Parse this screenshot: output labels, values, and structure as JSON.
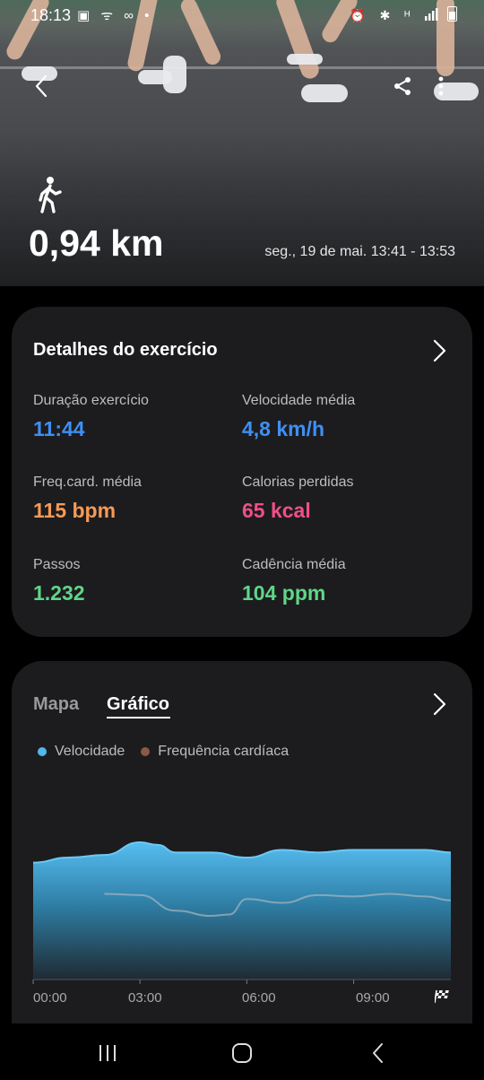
{
  "status_bar": {
    "time": "18:13",
    "left_icons": "▣ ᯤ ∞ •",
    "right_icons": "⏰ ✱ ᴴ"
  },
  "hero": {
    "distance": "0,94 km",
    "datetime": "seg., 19 de mai. 13:41 - 13:53",
    "icons": [
      "back-icon",
      "share-icon",
      "more-icon",
      "walking-icon"
    ]
  },
  "details": {
    "title": "Detalhes do exercício",
    "metrics": [
      {
        "label": "Duração exercício",
        "value": "11:44",
        "color": "#3f8ff3"
      },
      {
        "label": "Velocidade média",
        "value": "4,8 km/h",
        "color": "#3f8ff3"
      },
      {
        "label": "Freq.card. média",
        "value": "115 bpm",
        "color": "#f59a57"
      },
      {
        "label": "Calorias perdidas",
        "value": "65 kcal",
        "color": "#ef4f89"
      },
      {
        "label": "Passos",
        "value": "1.232",
        "color": "#5fd689"
      },
      {
        "label": "Cadência média",
        "value": "104 ppm",
        "color": "#5fd689"
      }
    ]
  },
  "chart_section": {
    "tabs": [
      "Mapa",
      "Gráfico"
    ],
    "active_tab": "Gráfico",
    "legend": [
      {
        "name": "Velocidade",
        "color": "#4fb8ec"
      },
      {
        "name": "Frequência cardíaca",
        "color": "#8a5a44"
      }
    ],
    "x_ticks": [
      "00:00",
      "03:00",
      "06:00",
      "09:00"
    ]
  },
  "chart_data": {
    "type": "area",
    "x_unit": "min",
    "x": [
      0,
      1,
      2,
      3,
      3.5,
      4,
      5,
      6,
      7,
      8,
      9,
      10,
      11,
      11.73
    ],
    "series": [
      {
        "name": "Velocidade",
        "values": [
          4.6,
          4.8,
          4.9,
          5.4,
          5.3,
          5.0,
          5.0,
          4.8,
          5.1,
          5.0,
          5.1,
          5.1,
          5.1,
          5.0
        ]
      },
      {
        "name": "Frequência cardíaca",
        "x": [
          2,
          3,
          4,
          5,
          5.5,
          6,
          7,
          8,
          9,
          10,
          11,
          11.73
        ],
        "values": [
          115,
          114,
          102,
          98,
          99,
          111,
          108,
          114,
          113,
          115,
          113,
          110
        ]
      }
    ],
    "xlim": [
      0,
      11.73
    ],
    "grid": false
  },
  "nav": {
    "buttons": [
      "recents-button",
      "home-button",
      "back-button"
    ]
  }
}
